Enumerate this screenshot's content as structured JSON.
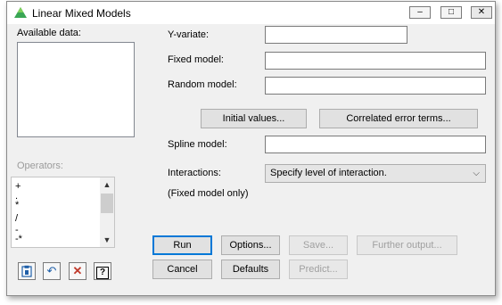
{
  "window": {
    "title": "Linear Mixed Models",
    "controls": {
      "minimize": "–",
      "maximize": "□",
      "close": "✕"
    }
  },
  "left": {
    "available_data_label": "Available data:",
    "operators_label": "Operators:",
    "operators": [
      "+",
      ".",
      "*",
      "/",
      "-",
      "-*"
    ]
  },
  "form": {
    "y_variate_label": "Y-variate:",
    "fixed_model_label": "Fixed model:",
    "random_model_label": "Random model:",
    "spline_model_label": "Spline model:",
    "interactions_label": "Interactions:",
    "interactions_value": "Specify level of interaction.",
    "fixed_model_only": "(Fixed model only)",
    "y_variate_value": "",
    "fixed_model_value": "",
    "random_model_value": "",
    "spline_model_value": ""
  },
  "buttons": {
    "initial_values": "Initial values...",
    "correlated_error_terms": "Correlated error terms...",
    "run": "Run",
    "options": "Options...",
    "save": "Save...",
    "further_output": "Further output...",
    "cancel": "Cancel",
    "defaults": "Defaults",
    "predict": "Predict..."
  },
  "toolbar": {
    "icons": [
      "clipboard-icon",
      "undo-icon",
      "clear-icon",
      "help-icon"
    ],
    "help_glyph": "?",
    "clear_glyph": "✕",
    "undo_glyph": "↶"
  },
  "colors": {
    "accent": "#0078d7",
    "window_bg": "#f0f0f0",
    "app_icon": "#3aa655"
  }
}
